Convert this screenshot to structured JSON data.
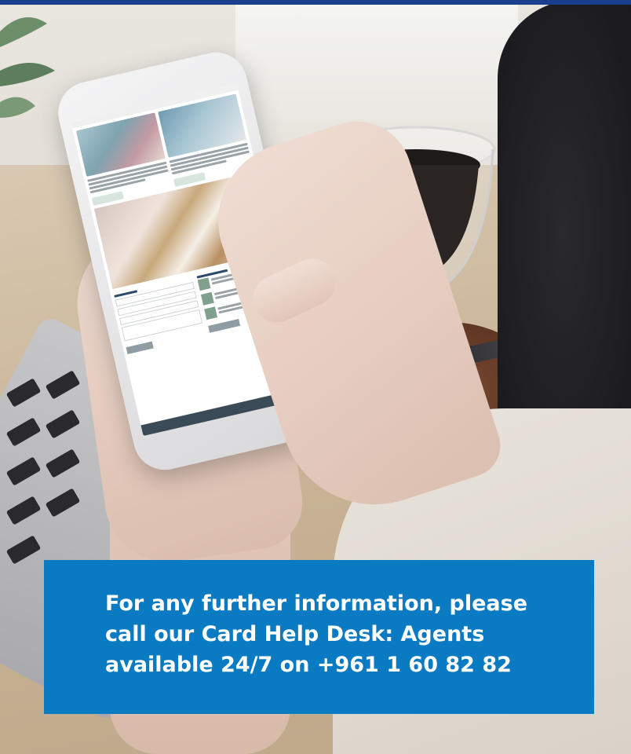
{
  "banner": {
    "line1": "For any further information, please",
    "line2": "call our Card Help Desk: Agents",
    "line3": "available 24/7 on +961 1 60 82 82"
  },
  "colors": {
    "banner_background": "#0a7bc2",
    "top_rule": "#1b3f8f",
    "banner_text": "#ffffff"
  }
}
